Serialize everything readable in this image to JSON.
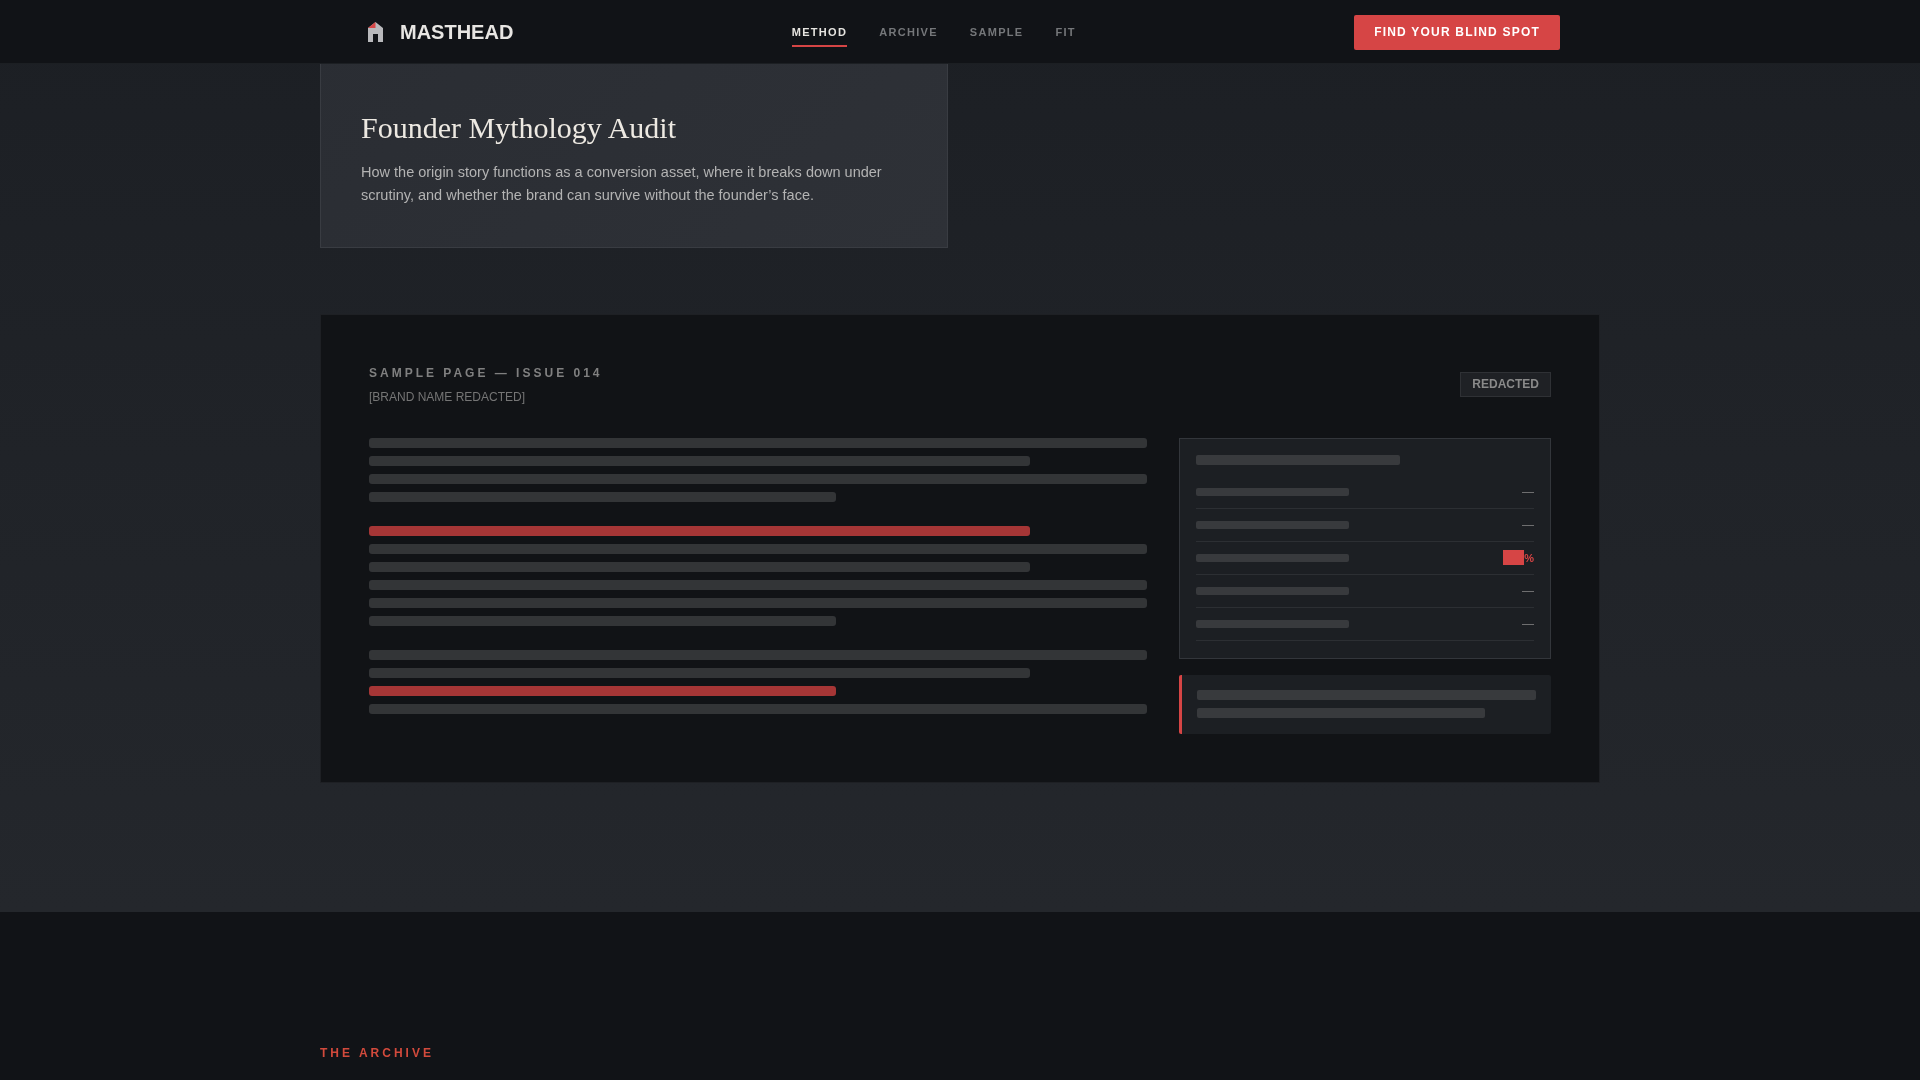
{
  "navbar": {
    "brand": "MASTHEAD",
    "links": [
      {
        "label": "METHOD",
        "selected": true
      },
      {
        "label": "ARCHIVE",
        "selected": false
      },
      {
        "label": "SAMPLE",
        "selected": false
      },
      {
        "label": "FIT",
        "selected": false
      }
    ],
    "cta": "FIND YOUR BLIND SPOT"
  },
  "method_card": {
    "title": "Founder Mythology Audit",
    "description": "How the origin story functions as a conversion asset, where it breaks down under scrutiny, and whether the brand can survive without the founder’s face."
  },
  "sample_page": {
    "title": "SAMPLE PAGE — ISSUE 014",
    "subtitle": "[BRAND NAME REDACTED]",
    "badge": "REDACTED",
    "body_groups": [
      [
        {
          "kind": "full",
          "highlighted": false
        },
        {
          "kind": "long",
          "highlighted": false
        },
        {
          "kind": "full",
          "highlighted": false
        },
        {
          "kind": "short",
          "highlighted": false
        }
      ],
      [
        {
          "kind": "long",
          "highlighted": true
        },
        {
          "kind": "full",
          "highlighted": false
        },
        {
          "kind": "long",
          "highlighted": false
        },
        {
          "kind": "full",
          "highlighted": false
        },
        {
          "kind": "full",
          "highlighted": false
        },
        {
          "kind": "short",
          "highlighted": false
        }
      ],
      [
        {
          "kind": "full",
          "highlighted": false
        },
        {
          "kind": "long",
          "highlighted": false
        },
        {
          "kind": "short",
          "highlighted": true
        },
        {
          "kind": "full",
          "highlighted": false
        }
      ]
    ],
    "stats_panel": {
      "rows": [
        {
          "value": "—",
          "redacted": false
        },
        {
          "value": "—",
          "redacted": false
        },
        {
          "value": "%",
          "redacted": true
        },
        {
          "value": "—",
          "redacted": false
        },
        {
          "value": "—",
          "redacted": false
        }
      ]
    },
    "callout": {
      "lines": [
        {
          "kind": "full"
        },
        {
          "kind": "long"
        }
      ]
    }
  },
  "archive": {
    "eyebrow": "THE ARCHIVE"
  }
}
